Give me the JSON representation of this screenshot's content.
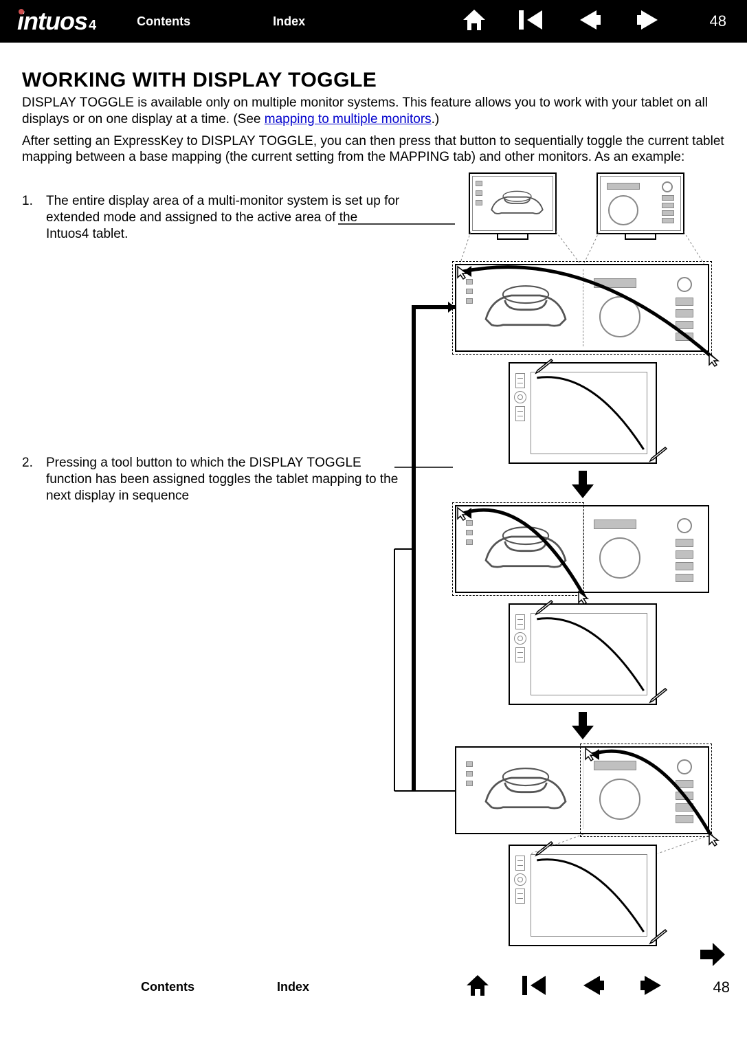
{
  "header": {
    "logo_main": "intuos",
    "logo_suffix": "4",
    "nav": {
      "contents": "Contents",
      "index": "Index"
    },
    "page_number": "48"
  },
  "main": {
    "title": "WORKING WITH DISPLAY TOGGLE",
    "para1_pre": "D",
    "para1_sc1": "ISPLAY ",
    "para1_tog": "T",
    "para1_sc2": "OGGLE",
    "para1_rest": " is available only on multiple monitor systems.  This feature allows you to work with your tablet on all displays or on one display at a time.  (See ",
    "para1_link": "mapping to multiple monitors",
    "para1_end": ".)",
    "para2_a": "After setting an ExpressKey to D",
    "para2_sc1": "ISPLAY ",
    "para2_t": "T",
    "para2_sc2": "OGGLE",
    "para2_b": ", you can then press that button to sequentially toggle the current tablet mapping between a base mapping (the current setting from the M",
    "para2_sc3": "APPING",
    "para2_c": " tab) and other monitors.  As an example:",
    "steps": [
      {
        "num": "1.",
        "text": "The entire display area of a multi-monitor system is set up for extended mode and assigned to the active area of the Intuos4 tablet."
      },
      {
        "num": "2.",
        "text_a": "Pressing a tool button to which the D",
        "sc1": "ISPLAY ",
        "t": "T",
        "sc2": "OGGLE",
        "text_b": " function has been assigned toggles the tablet mapping to the next display in sequence"
      }
    ]
  },
  "footer": {
    "nav": {
      "contents": "Contents",
      "index": "Index"
    },
    "page_number": "48"
  }
}
